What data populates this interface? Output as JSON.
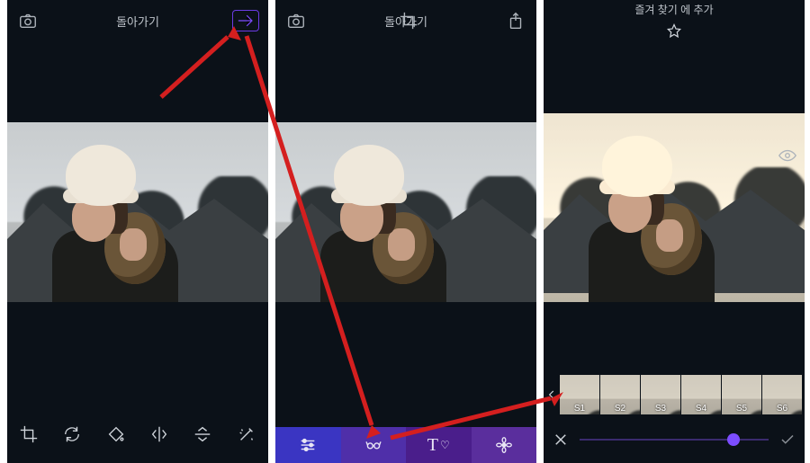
{
  "screen1": {
    "back_label": "돌아가기",
    "top_icons": {
      "camera": "camera-icon",
      "next": "next-icon"
    },
    "tool_icons": [
      "crop",
      "refresh",
      "bucket",
      "mirror",
      "flip-v",
      "wand"
    ]
  },
  "screen2": {
    "back_label": "돌아가기",
    "top_icons": {
      "camera": "camera-icon",
      "crop": "crop-icon",
      "share": "share-icon"
    },
    "tabs": [
      {
        "id": "adjust",
        "icon": "sliders-icon"
      },
      {
        "id": "looks",
        "icon": "glasses-icon"
      },
      {
        "id": "text",
        "label": "T",
        "heart": "♡"
      },
      {
        "id": "effects",
        "icon": "flower-icon"
      }
    ]
  },
  "screen3": {
    "title": "즐겨 찾기 에 추가",
    "favorite_icon": "star-outline-icon",
    "preview_icon": "eye-icon",
    "filters": [
      "S1",
      "S2",
      "S3",
      "S4",
      "S5",
      "S6"
    ],
    "selected_filter": "S4",
    "slider": {
      "value": 0.78
    },
    "cancel_icon": "x-icon",
    "confirm_icon": "check-icon"
  },
  "colors": {
    "accent": "#7c4dff",
    "accent2": "#3a35c2"
  }
}
